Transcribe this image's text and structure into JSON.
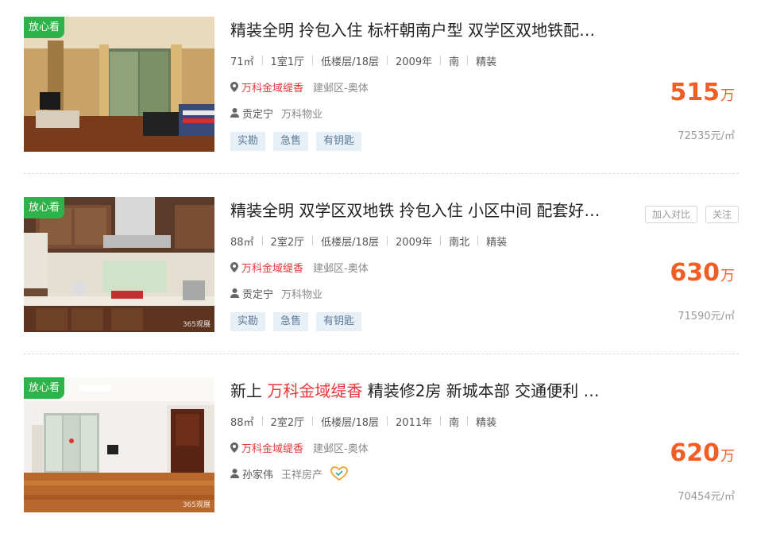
{
  "listings": [
    {
      "badge": "放心看",
      "watermark": "",
      "title_parts": [
        "精装全明 拎包入住 标杆朝南户型 双学区双地铁配…"
      ],
      "title_highlight": "",
      "title_rest": "",
      "attrs": [
        "71㎡",
        "1室1厅",
        "低楼层/18层",
        "2009年",
        "南",
        "精装"
      ],
      "community": "万科金域缇香",
      "district": "建邺区-奥体",
      "agent_name": "贡定宁",
      "agent_company": "万科物业",
      "show_heart_badge": false,
      "tags": [
        "实勘",
        "急售",
        "有钥匙"
      ],
      "price": "515",
      "price_unit": "万",
      "unit_price": "72535元/㎡",
      "actions": []
    },
    {
      "badge": "放心看",
      "watermark": "365观展",
      "title_parts": [
        "精装全明 双学区双地铁 拎包入住 小区中间 配套好…"
      ],
      "title_highlight": "",
      "title_rest": "",
      "attrs": [
        "88㎡",
        "2室2厅",
        "低楼层/18层",
        "2009年",
        "南北",
        "精装"
      ],
      "community": "万科金域缇香",
      "district": "建邺区-奥体",
      "agent_name": "贡定宁",
      "agent_company": "万科物业",
      "show_heart_badge": false,
      "tags": [
        "实勘",
        "急售",
        "有钥匙"
      ],
      "price": "630",
      "price_unit": "万",
      "unit_price": "71590元/㎡",
      "actions": [
        "加入对比",
        "关注"
      ]
    },
    {
      "badge": "放心看",
      "watermark": "365观展",
      "title_parts": [
        "新上 "
      ],
      "title_highlight": "万科金域缇香",
      "title_rest": " 精装修2房 新城本部 交通便利 …",
      "attrs": [
        "88㎡",
        "2室2厅",
        "低楼层/18层",
        "2011年",
        "南",
        "精装"
      ],
      "community": "万科金域缇香",
      "district": "建邺区-奥体",
      "agent_name": "孙家伟",
      "agent_company": "王祥房产",
      "show_heart_badge": true,
      "tags": [],
      "price": "620",
      "price_unit": "万",
      "unit_price": "70454元/㎡",
      "actions": []
    }
  ],
  "icons": {
    "location": "map-pin-icon",
    "agent": "person-icon",
    "heart": "heart-badge-icon"
  },
  "colors": {
    "badge_green": "#2db34a",
    "price_orange": "#f25d23",
    "highlight_red": "#e4393c",
    "tag_bg": "#e8f0f7"
  }
}
